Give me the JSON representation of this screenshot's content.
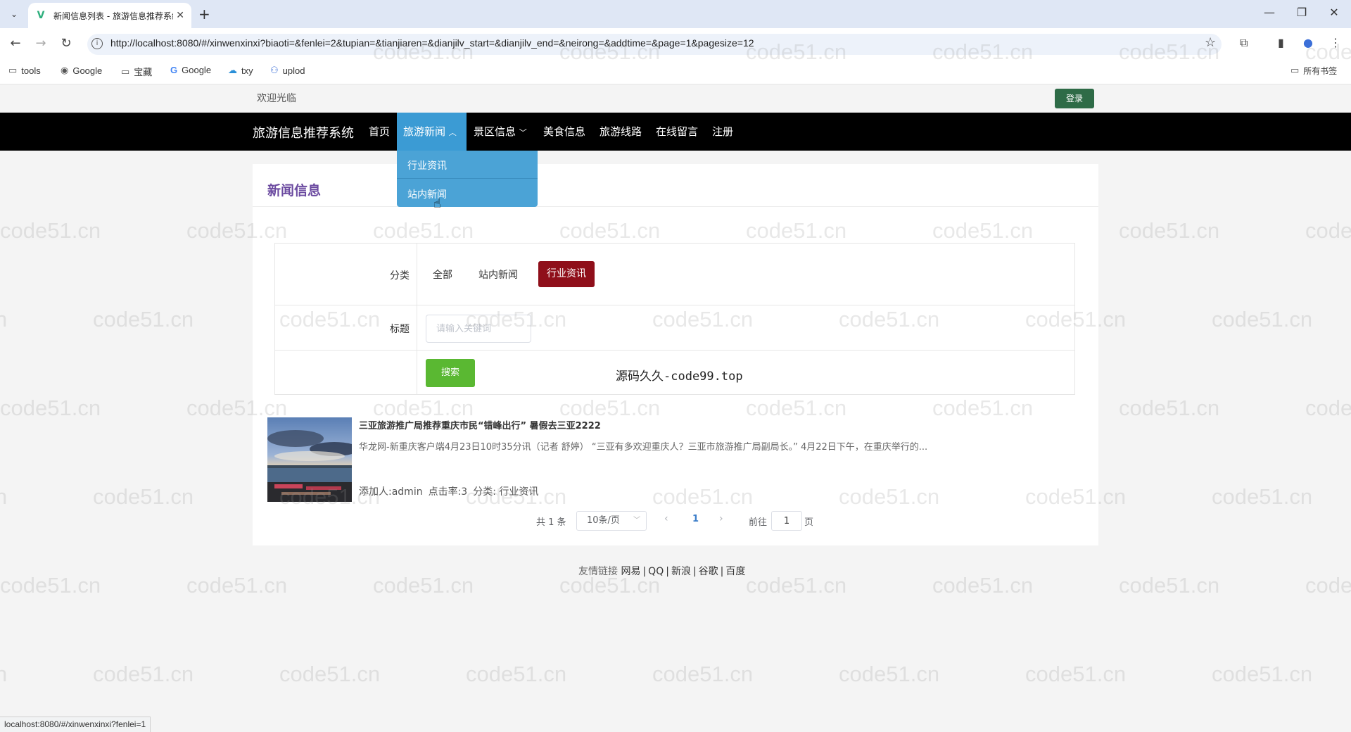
{
  "browser": {
    "tab_title": "新闻信息列表 - 旅游信息推荐系统",
    "url": "http://localhost:8080/#/xinwenxinxi?biaoti=&fenlei=2&tupian=&tianjiaren=&dianjilv_start=&dianjilv_end=&neirong=&addtime=&page=1&pagesize=12",
    "bookmarks": [
      "tools",
      "Google",
      "宝藏",
      "Google",
      "txy",
      "uplod"
    ],
    "all_bookmarks": "所有书签",
    "status_url": "localhost:8080/#/xinwenxinxi?fenlei=1"
  },
  "header": {
    "welcome": "欢迎光临",
    "login": "登录"
  },
  "nav": {
    "brand": "旅游信息推荐系统",
    "items": [
      "首页",
      "旅游新闻",
      "景区信息",
      "美食信息",
      "旅游线路",
      "在线留言",
      "注册"
    ],
    "dropdown": [
      "行业资讯",
      "站内新闻"
    ]
  },
  "page": {
    "title": "新闻信息",
    "filter": {
      "category_label": "分类",
      "categories": [
        "全部",
        "站内新闻",
        "行业资讯"
      ],
      "selected_category": "行业资讯",
      "title_label": "标题",
      "title_placeholder": "请输入关键词",
      "search_label": "搜索",
      "source_text": "源码久久-code99.top"
    },
    "news": [
      {
        "title": "三亚旅游推广局推荐重庆市民“错峰出行” 暑假去三亚2222",
        "summary": "华龙网-新重庆客户端4月23日10时35分讯（记者 舒婷） “三亚有多欢迎重庆人？三亚市旅游推广局副局长。” 4月22日下午，在重庆举行的...",
        "author": "添加人:admin",
        "clicks": "点击率:3",
        "category": "分类: 行业资讯"
      }
    ],
    "pagination": {
      "total": "共 1 条",
      "page_size": "10条/页",
      "current": "1",
      "goto_label": "前往",
      "goto_value": "1",
      "page_suffix": "页"
    }
  },
  "footer": {
    "label": "友情链接",
    "links": [
      "网易",
      "QQ",
      "新浪",
      "谷歌",
      "百度"
    ]
  },
  "watermark": "code51.cn"
}
